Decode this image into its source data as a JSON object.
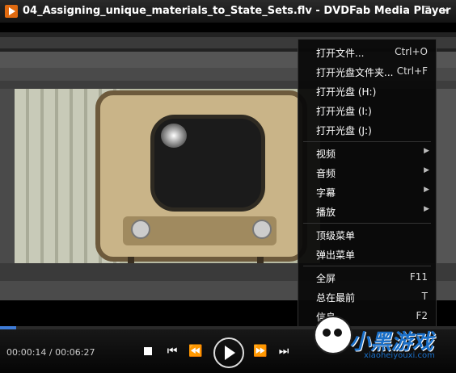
{
  "window": {
    "title": "04_Assigning_unique_materials_to_State_Sets.flv - DVDFab Media Player",
    "controls": [
      "–",
      "❐",
      "✕"
    ]
  },
  "context_menu": {
    "items": [
      {
        "label": "打开文件...",
        "shortcut": "Ctrl+O"
      },
      {
        "label": "打开光盘文件夹...",
        "shortcut": "Ctrl+F"
      },
      {
        "label": "打开光盘 (H:)",
        "shortcut": ""
      },
      {
        "label": "打开光盘 (I:)",
        "shortcut": ""
      },
      {
        "label": "打开光盘 (J:)",
        "shortcut": ""
      },
      {
        "label": "视频",
        "submenu": true
      },
      {
        "label": "音频",
        "submenu": true
      },
      {
        "label": "字幕",
        "submenu": true
      },
      {
        "label": "播放",
        "submenu": true
      },
      {
        "label": "顶级菜单",
        "shortcut": ""
      },
      {
        "label": "弹出菜单",
        "shortcut": ""
      },
      {
        "label": "全屏",
        "shortcut": "F11"
      },
      {
        "label": "总在最前",
        "shortcut": "T"
      },
      {
        "label": "信息",
        "shortcut": "F2"
      }
    ]
  },
  "player": {
    "current_time": "00:00:14",
    "total_time": "00:06:27",
    "time_display": "00:00:14 / 00:06:27",
    "progress_fraction": 0.036,
    "accent_color": "#3e7bd6"
  },
  "watermark": {
    "text": "小黑游戏",
    "url": "xiaoheiyouxi.com"
  }
}
